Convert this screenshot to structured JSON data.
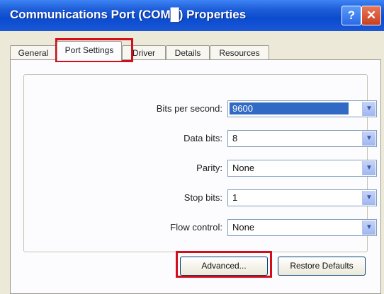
{
  "window": {
    "title": "Communications Port (COM█) Properties",
    "help_glyph": "?",
    "close_glyph": "✕"
  },
  "tabs": [
    {
      "label": "General"
    },
    {
      "label": "Port Settings",
      "active": true
    },
    {
      "label": "Driver"
    },
    {
      "label": "Details"
    },
    {
      "label": "Resources"
    }
  ],
  "settings": [
    {
      "label": "Bits per second:",
      "value": "9600",
      "selected": true
    },
    {
      "label": "Data bits:",
      "value": "8"
    },
    {
      "label": "Parity:",
      "value": "None"
    },
    {
      "label": "Stop bits:",
      "value": "1"
    },
    {
      "label": "Flow control:",
      "value": "None"
    }
  ],
  "buttons": {
    "advanced": "Advanced...",
    "restore_defaults": "Restore Defaults"
  },
  "colors": {
    "title_blue": "#0a4bcf",
    "highlight_red": "#d40d1b",
    "selection": "#316ac5"
  },
  "icons": {
    "dropdown": "chevron-down-icon"
  }
}
